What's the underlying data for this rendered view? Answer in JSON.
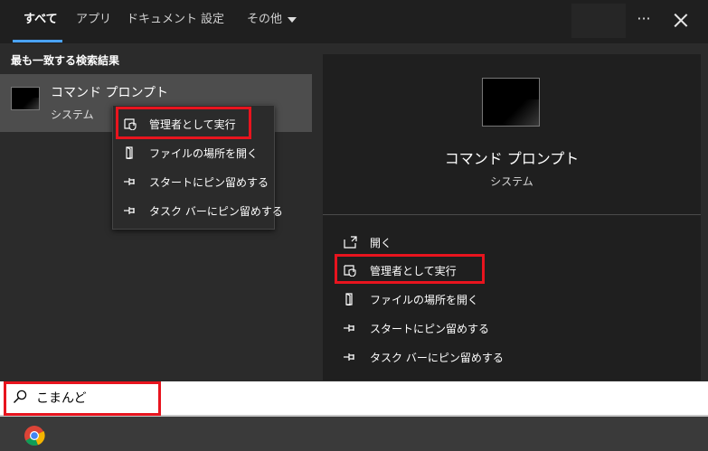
{
  "tabs": [
    {
      "label": "すべて",
      "active": true
    },
    {
      "label": "アプリ"
    },
    {
      "label": "ドキュメント"
    },
    {
      "label": "設定"
    },
    {
      "label": "その他"
    }
  ],
  "header": {
    "more_icon": "ellipsis-icon",
    "close_icon": "close-icon"
  },
  "best_match": {
    "title": "最も一致する検索結果",
    "result": {
      "name": "コマンド プロンプト",
      "type": "システム",
      "icon": "command-prompt-icon"
    }
  },
  "context_menu": {
    "items": [
      {
        "label": "管理者として実行",
        "icon": "shield-icon"
      },
      {
        "label": "ファイルの場所を開く",
        "icon": "file-location-icon"
      },
      {
        "label": "スタートにピン留めする",
        "icon": "pin-icon"
      },
      {
        "label": "タスク バーにピン留めする",
        "icon": "pin-icon"
      }
    ]
  },
  "preview": {
    "title": "コマンド プロンプト",
    "subtitle": "システム",
    "actions": [
      {
        "label": "開く",
        "icon": "open-icon"
      },
      {
        "label": "管理者として実行",
        "icon": "shield-icon"
      },
      {
        "label": "ファイルの場所を開く",
        "icon": "file-location-icon"
      },
      {
        "label": "スタートにピン留めする",
        "icon": "pin-icon"
      },
      {
        "label": "タスク バーにピン留めする",
        "icon": "pin-icon"
      }
    ]
  },
  "search": {
    "value": "こまんど",
    "icon": "search-icon"
  },
  "taskbar": {
    "items": [
      {
        "icon": "chrome-icon"
      }
    ]
  },
  "colors": {
    "highlight": "#e8141e",
    "accent": "#4aa3ff",
    "row_selected": "#4d4d4d"
  }
}
